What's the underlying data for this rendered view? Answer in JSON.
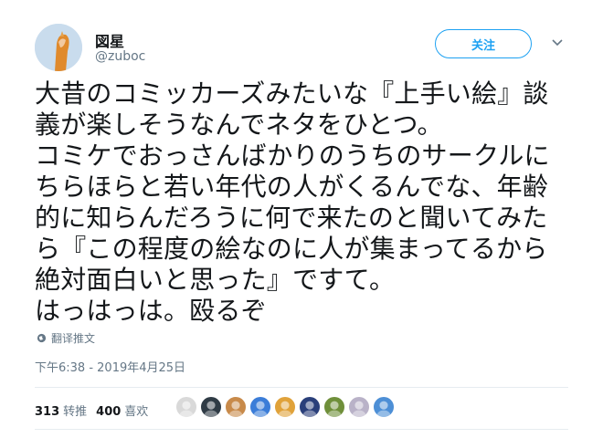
{
  "user": {
    "display_name": "図星",
    "handle": "@zuboc"
  },
  "follow_button": {
    "label": "关注"
  },
  "tweet": {
    "lines": [
      "大昔のコミッカーズみたいな『上手い絵』談",
      "義が楽しそうなんでネタをひとつ。",
      "コミケでおっさんばかりのうちのサークルに",
      "ちらほらと若い年代の人がくるんでな、年齢",
      "的に知らんだろうに何で来たのと聞いてみた",
      "ら『この程度の絵なのに人が集まってるから",
      "絶対面白いと思った』ですて。",
      "はっはっは。殴るぞ"
    ],
    "translate_label": "翻译推文",
    "timestamp": "下午6:38 - 2019年4月25日"
  },
  "stats": {
    "retweets_count": "313",
    "retweets_label": "转推",
    "likes_count": "400",
    "likes_label": "喜欢"
  },
  "likers": [
    {
      "icon": "liker-avatar-1",
      "color": "#d9d9d9"
    },
    {
      "icon": "liker-avatar-2",
      "color": "#2f3b45"
    },
    {
      "icon": "liker-avatar-3",
      "color": "#c88a4a"
    },
    {
      "icon": "liker-avatar-4",
      "color": "#3b7dd8"
    },
    {
      "icon": "liker-avatar-5",
      "color": "#e0a23a"
    },
    {
      "icon": "liker-avatar-6",
      "color": "#2a3f7a"
    },
    {
      "icon": "liker-avatar-7",
      "color": "#6f8f3a"
    },
    {
      "icon": "liker-avatar-8",
      "color": "#b9b2c8"
    },
    {
      "icon": "liker-avatar-9",
      "color": "#4d8fd6"
    }
  ],
  "colors": {
    "accent": "#1da1f2",
    "muted": "#657786",
    "text": "#14171a"
  }
}
